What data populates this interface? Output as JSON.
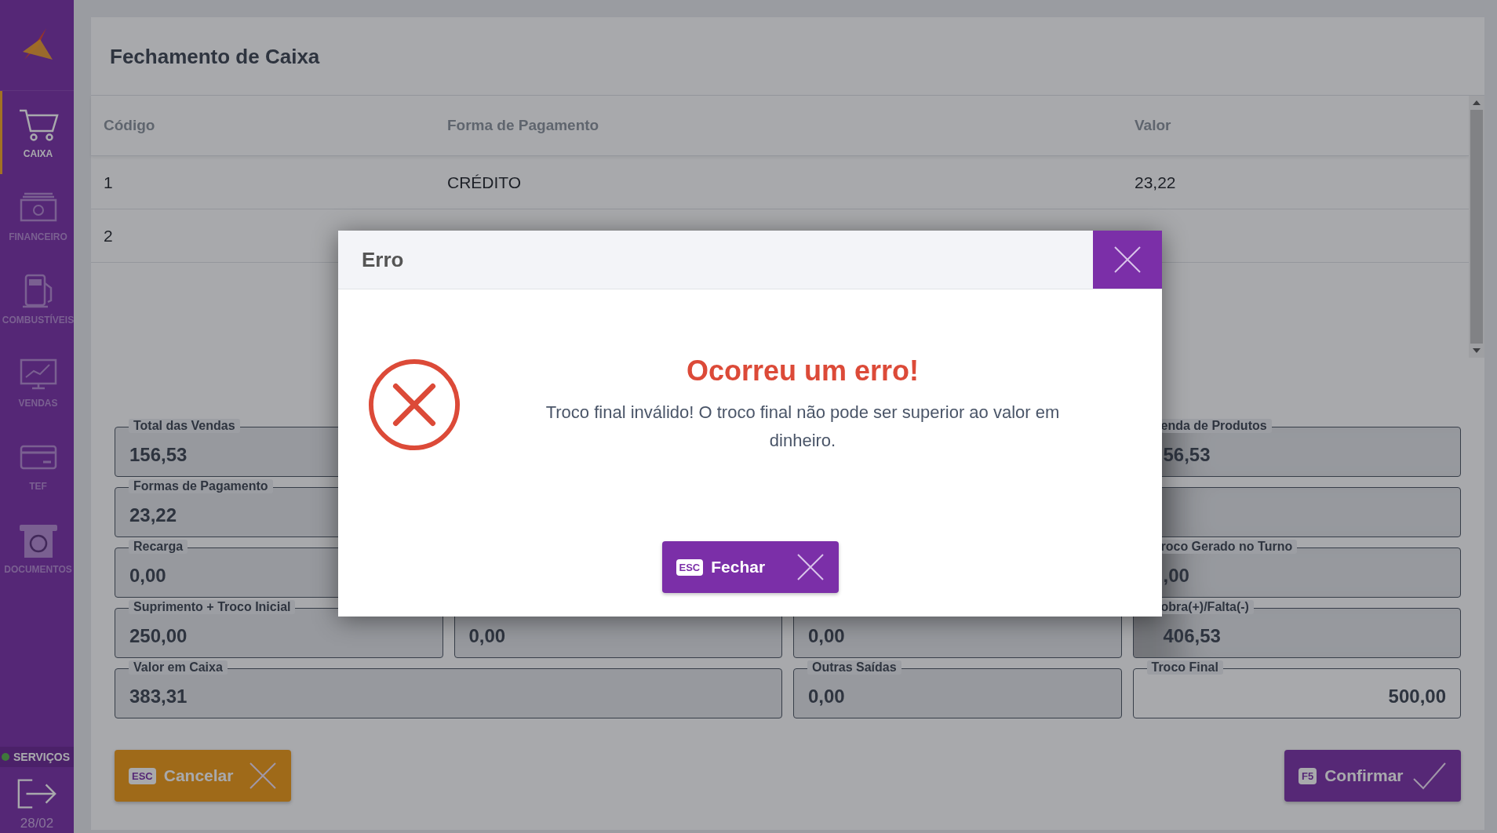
{
  "sidebar": {
    "items": [
      {
        "label": "CAIXA",
        "selected": true
      },
      {
        "label": "FINANCEIRO",
        "selected": false
      },
      {
        "label": "COMBUSTÍVEIS",
        "selected": false
      },
      {
        "label": "VENDAS",
        "selected": false
      },
      {
        "label": "TEF",
        "selected": false
      },
      {
        "label": "DOCUMENTOS",
        "selected": false
      }
    ],
    "services": {
      "label": "SERVIÇOS",
      "online": true
    },
    "date": "28/02"
  },
  "page": {
    "title": "Fechamento de Caixa"
  },
  "table": {
    "columns": [
      "Código",
      "Forma de Pagamento",
      "Valor"
    ],
    "rows": [
      {
        "cells": [
          "1",
          "CRÉDITO",
          "23,22"
        ]
      },
      {
        "cells": [
          "2"
        ]
      }
    ]
  },
  "fields": [
    {
      "kind": "display",
      "label": "Total das Vendas",
      "value": "156,53"
    },
    {
      "kind": "display",
      "label": "enda de Produtos",
      "value": "56,53",
      "covered": true
    },
    {
      "kind": "display",
      "label": "Formas de Pagamento",
      "value": "23,22"
    },
    {
      "kind": "display",
      "covered": true
    },
    {
      "kind": "display",
      "label": "Recarga",
      "value": "0,00"
    },
    {
      "kind": "display",
      "label": "roco Gerado no Turno",
      "value": ",00",
      "covered": true
    },
    {
      "kind": "display",
      "label": "Suprimento + Troco Inicial",
      "value": "250,00"
    },
    {
      "kind": "display",
      "value": "0,00"
    },
    {
      "kind": "display",
      "value": "0,00"
    },
    {
      "kind": "display",
      "label": "obra(+)/Falta(-)",
      "value": "406,53",
      "covered": true
    },
    {
      "kind": "display",
      "label": "Valor em Caixa",
      "value": "383,31",
      "wide": true
    },
    {
      "kind": "display",
      "label": "Outras Saídas",
      "value": "0,00"
    },
    {
      "kind": "input",
      "label": "Troco Final",
      "value": "500,00"
    }
  ],
  "actions": [
    {
      "kind": "cancel",
      "key": "ESC",
      "label": "Cancelar"
    },
    {
      "kind": "confirm",
      "key": "F5",
      "label": "Confirmar"
    }
  ],
  "modal": {
    "title": "Erro",
    "heading": "Ocorreu um erro!",
    "message": "Troco final inválido! O troco final não pode ser superior ao valor em dinheiro.",
    "button": {
      "key": "ESC",
      "label": "Fechar"
    }
  }
}
